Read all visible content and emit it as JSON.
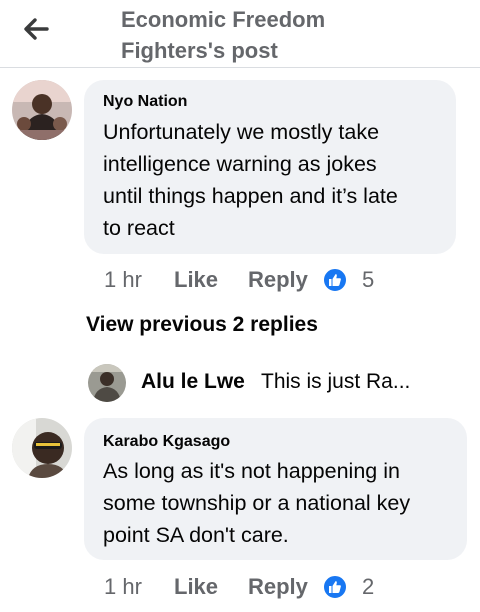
{
  "header": {
    "title_line1": "Economic Freedom",
    "title_line2": "Fighters's post"
  },
  "comments": [
    {
      "author": "Nyo Nation",
      "lines": [
        "Unfortunately we mostly take",
        "intelligence warning as jokes",
        "until things happen and it’s late",
        "to react"
      ],
      "time": "1 hr",
      "like_label": "Like",
      "reply_label": "Reply",
      "reaction_count": "5"
    },
    {
      "author": "Karabo Kgasago",
      "lines": [
        "As long as it's not happening in",
        "some township or a national key",
        "point SA don't care."
      ],
      "time": "1 hr",
      "like_label": "Like",
      "reply_label": "Reply",
      "reaction_count": "2"
    }
  ],
  "replies": {
    "view_previous_label": "View previous 2 replies",
    "preview_author": "Alu le Lwe",
    "preview_text": "This is just Ra..."
  },
  "colors": {
    "accent": "#1877f2",
    "bubble": "#f0f2f5",
    "secondary_text": "#65676b"
  },
  "icons": {
    "back": "arrow-left-icon",
    "reaction": "thumbs-up-icon"
  }
}
